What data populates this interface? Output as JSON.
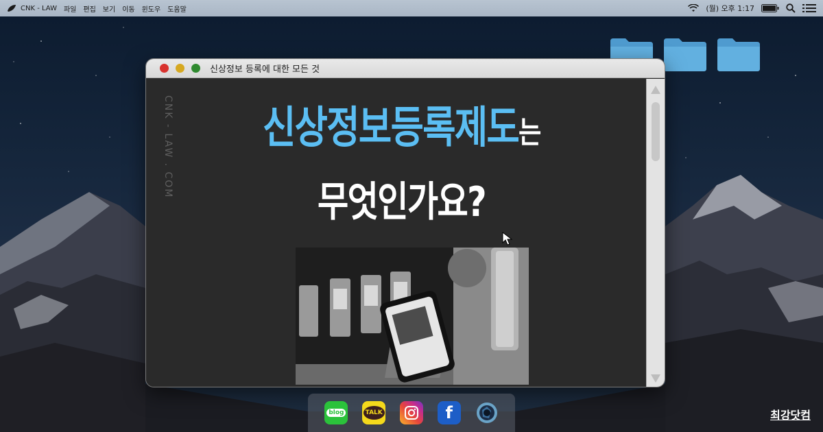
{
  "menubar": {
    "app_name": "CNK - LAW",
    "items": [
      "파일",
      "편집",
      "보기",
      "이동",
      "윈도우",
      "도움말"
    ],
    "clock": "(월) 오후 1:17"
  },
  "window": {
    "title": "신상정보 등록에 대한 모든 것",
    "vertical_text": "CNK - LAW . COM",
    "headline_accent": "신상정보등록제도",
    "headline_suffix": "는",
    "headline_line2": "무엇인가요?"
  },
  "dock": {
    "items": [
      {
        "name": "blog",
        "label": "blog",
        "color": "#2bc23b"
      },
      {
        "name": "kakaotalk",
        "label": "TALK",
        "color": "#f4d91c"
      },
      {
        "name": "instagram",
        "label": ""
      },
      {
        "name": "facebook",
        "label": "f",
        "color": "#1d5ec7"
      },
      {
        "name": "camera",
        "label": ""
      }
    ]
  },
  "brand": "최강닷컴",
  "colors": {
    "accent": "#5bbef3",
    "window_bg": "#2a2a2a",
    "folder": "#5aa9d9"
  }
}
